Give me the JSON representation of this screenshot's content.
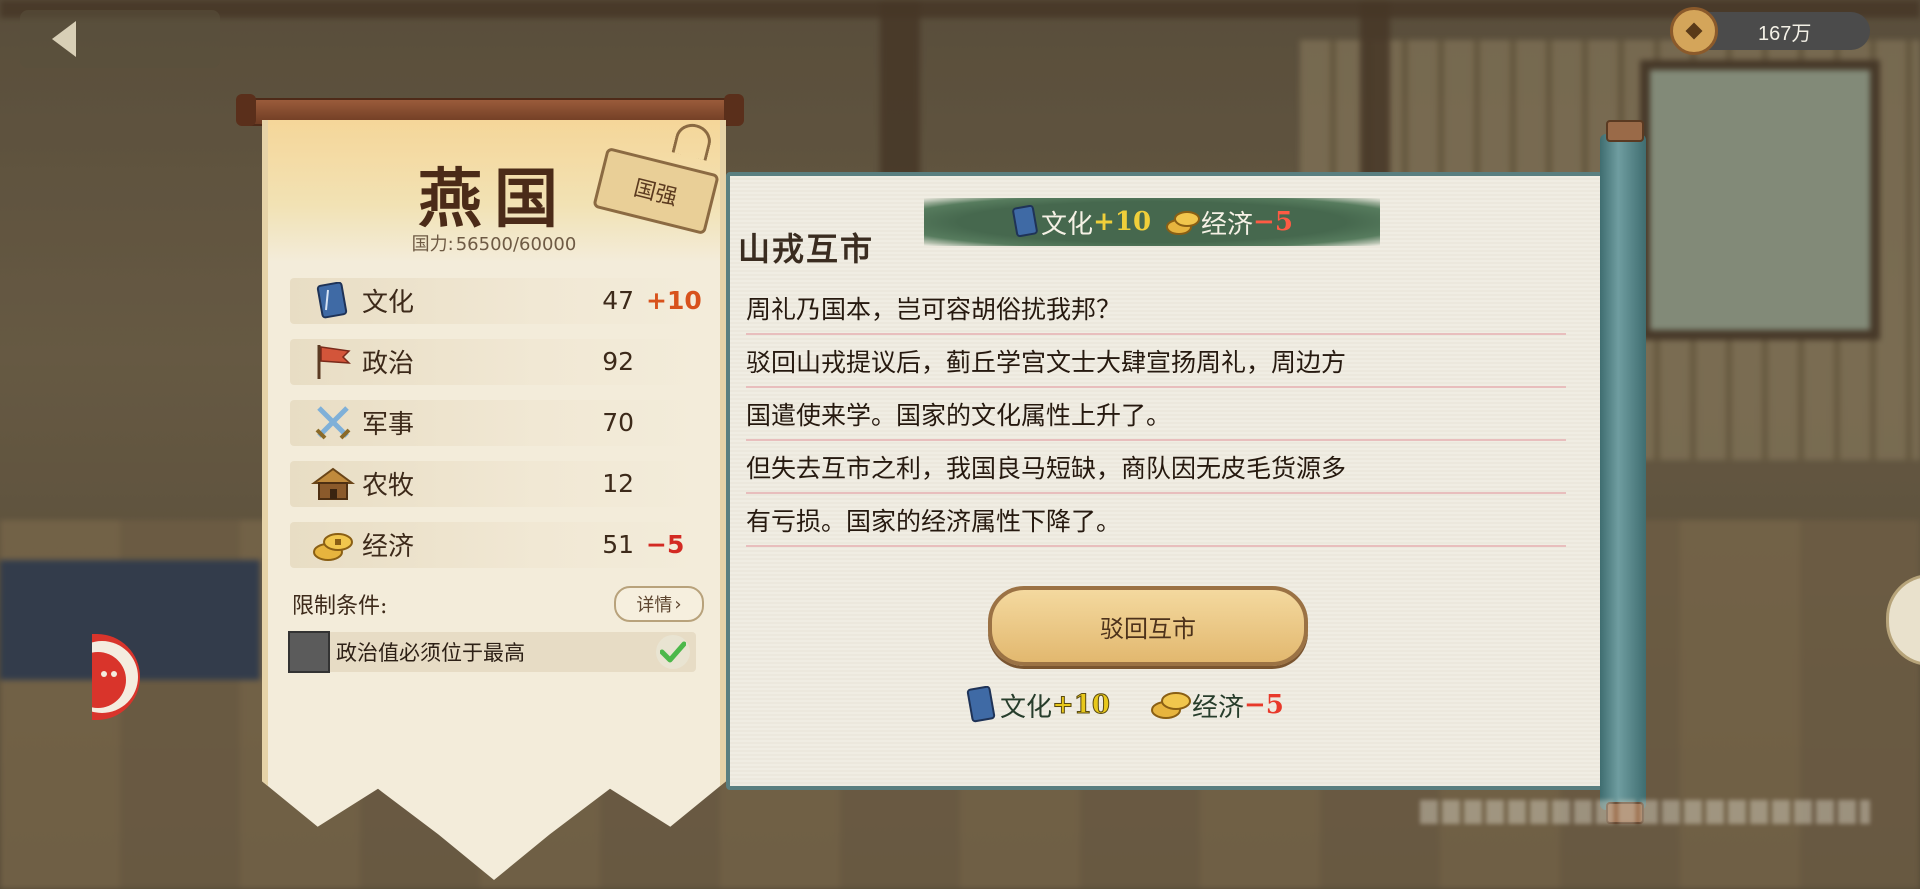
{
  "currency": {
    "amount": "167万",
    "icon": "copper-coin-icon"
  },
  "nation": {
    "name": "燕国",
    "power_label": "国力:",
    "power_value": "56500/60000",
    "tag": "国强",
    "attributes": [
      {
        "name": "文化",
        "value": "47",
        "delta": "+10",
        "icon": "book-icon"
      },
      {
        "name": "政治",
        "value": "92",
        "delta": "",
        "icon": "flag-icon"
      },
      {
        "name": "军事",
        "value": "70",
        "delta": "",
        "icon": "crossed-swords-icon"
      },
      {
        "name": "农牧",
        "value": "12",
        "delta": "",
        "icon": "farmhouse-icon"
      },
      {
        "name": "经济",
        "value": "51",
        "delta": "−5",
        "icon": "gold-coins-icon"
      }
    ],
    "restriction": {
      "title": "限制条件:",
      "detail_label": "详情",
      "condition": "政治值必须位于最高",
      "met": true
    }
  },
  "event": {
    "title": "山戎互市",
    "effects": [
      {
        "label": "文化",
        "value": "+10",
        "dir": "up",
        "icon": "book-icon"
      },
      {
        "label": "经济",
        "value": "−5",
        "dir": "down",
        "icon": "gold-coins-icon"
      }
    ],
    "lines": [
      "周礼乃国本，岂可容胡俗扰我邦？",
      "驳回山戎提议后，蓟丘学宫文士大肆宣扬周礼，周边方",
      "国遣使来学。国家的文化属性上升了。",
      "但失去互市之利，我国良马短缺，商队因无皮毛货源多",
      "有亏损。国家的经济属性下降了。"
    ],
    "choice": {
      "label": "驳回互市",
      "effects": [
        {
          "label": "文化",
          "value": "+10",
          "dir": "up"
        },
        {
          "label": "经济",
          "value": "−5",
          "dir": "down"
        }
      ]
    }
  },
  "colors": {
    "scroll_border": "#5a7f80",
    "up": "#d8521c",
    "down": "#d32a23",
    "banner": "#46684e"
  }
}
